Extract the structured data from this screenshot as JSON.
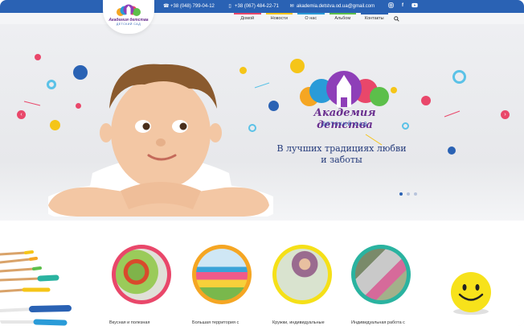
{
  "topbar": {
    "phone1": "+38 (048) 799-04-12",
    "phone2": "+38 (067) 484-22-71",
    "email": "akademia.detstva.od.ua@gmail.com",
    "social": [
      "instagram-icon",
      "facebook-icon",
      "youtube-icon"
    ]
  },
  "logo": {
    "title": "Академия детства",
    "subtitle": "ДЕТСКИЙ САД"
  },
  "nav": {
    "items": [
      {
        "label": "Домой",
        "color": "#e9476a"
      },
      {
        "label": "Новости",
        "color": "#f5c518"
      },
      {
        "label": "О нас",
        "color": "#2a9bd8"
      },
      {
        "label": "Альбом",
        "color": "#5cbf4a"
      },
      {
        "label": "Контакты",
        "color": "#2a62b4"
      }
    ],
    "search_icon": "search-icon"
  },
  "hero": {
    "brand_title": "Академия детства",
    "brand_subtitle": "ДЕТСКИЙ САД",
    "slogan_line1": "В лучших традициях любви",
    "slogan_line2": "и заботы",
    "slides": 3,
    "active_slide": 1
  },
  "features": [
    {
      "label": "Вкусная и полезная",
      "ring": "#e9476a"
    },
    {
      "label": "Большая территория с",
      "ring": "#f5a623"
    },
    {
      "label": "Кружки, индивидуальные",
      "ring": "#f5e018"
    },
    {
      "label": "Индивидуальная работа с",
      "ring": "#2ab3a0"
    }
  ],
  "colors": {
    "topbar": "#2a62b4",
    "brand": "#6a2f8f",
    "slider_arrow": "#e9476a"
  }
}
